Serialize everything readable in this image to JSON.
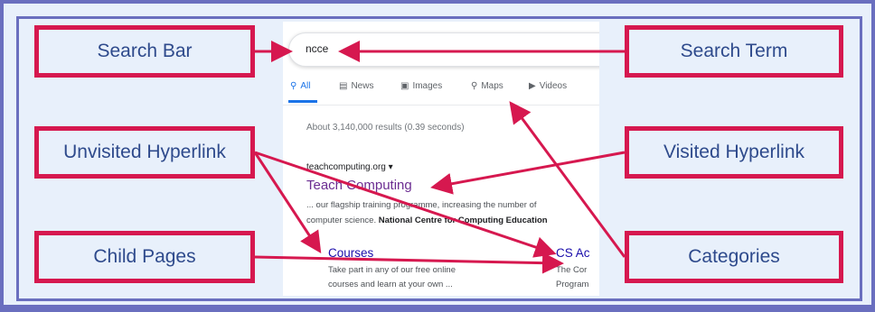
{
  "labels": {
    "search_bar": "Search Bar",
    "search_term": "Search Term",
    "unvisited_hyperlink": "Unvisited Hyperlink",
    "visited_hyperlink": "Visited Hyperlink",
    "child_pages": "Child Pages",
    "categories": "Categories"
  },
  "screenshot": {
    "query": "ncce",
    "tabs": [
      {
        "icon": "search-icon",
        "label": "All"
      },
      {
        "icon": "news-icon",
        "label": "News"
      },
      {
        "icon": "images-icon",
        "label": "Images"
      },
      {
        "icon": "maps-icon",
        "label": "Maps"
      },
      {
        "icon": "videos-icon",
        "label": "Videos"
      }
    ],
    "result_stats": "About 3,140,000 results (0.39 seconds)",
    "result_site": "teachcomputing.org",
    "result_title": "Teach Computing",
    "snippet_line1": "... our flagship training programme, increasing the number of",
    "snippet_line2_start": "computer science.",
    "snippet_line2_bold": "National Centre for Computing Education",
    "child_page_1": {
      "title": "Courses",
      "line1": "Take part in any of our free online",
      "line2": "courses and learn at your own ..."
    },
    "child_page_2": {
      "title": "CS Ac",
      "line1": "The Cor",
      "line2": "Program"
    }
  },
  "colors": {
    "frame": "#6a6fbf",
    "background": "#e8f0fb",
    "label_border": "#d6184f",
    "label_text": "#2e4a8c",
    "arrow": "#d6184f",
    "visited_link": "#6b2c91",
    "unvisited_link": "#1a0dab",
    "active_tab": "#1a73e8"
  }
}
